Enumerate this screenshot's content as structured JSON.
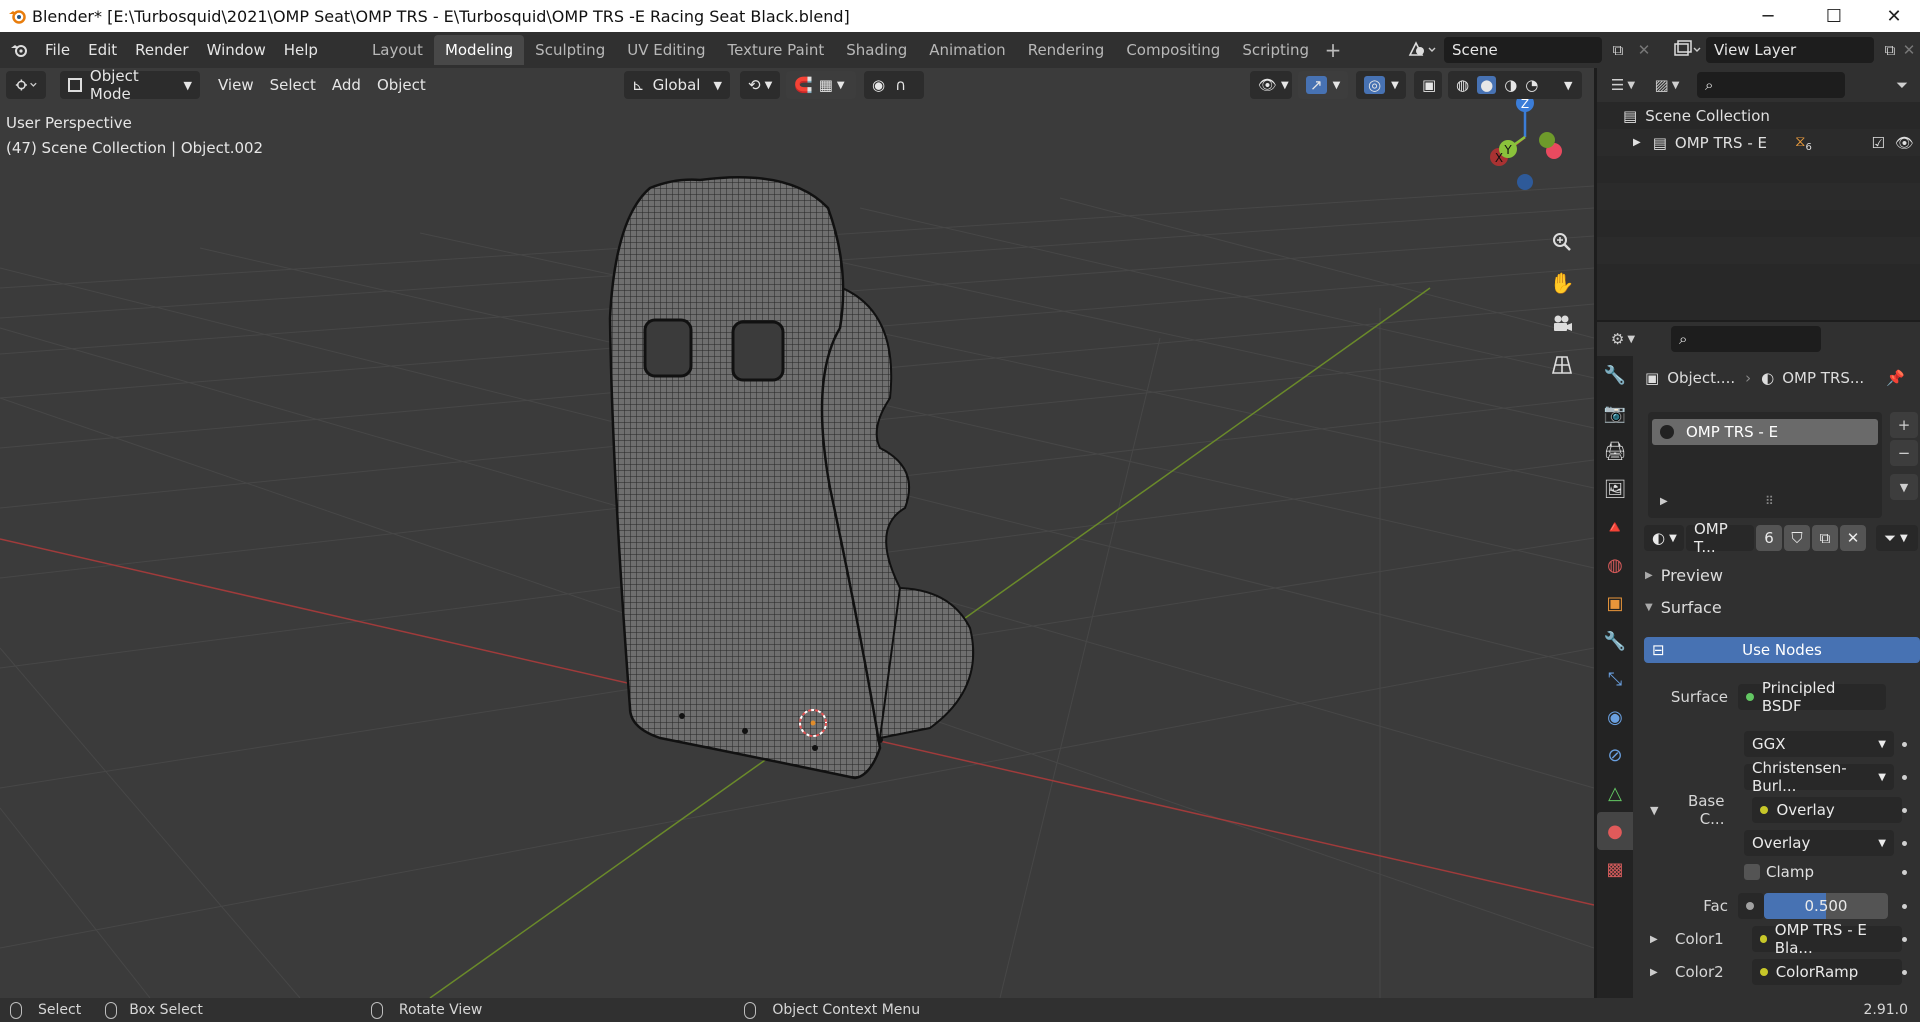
{
  "window": {
    "title": "Blender* [E:\\Turbosquid\\2021\\OMP Seat\\OMP TRS - E\\Turbosquid\\OMP TRS -E Racing Seat Black.blend]",
    "minimize": "─",
    "maximize": "☐",
    "close": "✕"
  },
  "menu": {
    "items": [
      "File",
      "Edit",
      "Render",
      "Window",
      "Help"
    ]
  },
  "workspaces": {
    "tabs": [
      "Layout",
      "Modeling",
      "Sculpting",
      "UV Editing",
      "Texture Paint",
      "Shading",
      "Animation",
      "Rendering",
      "Compositing",
      "Scripting"
    ],
    "active": "Modeling",
    "add": "+"
  },
  "scene": {
    "name": "Scene",
    "view_layer": "View Layer"
  },
  "viewport": {
    "mode": "Object Mode",
    "menus": [
      "View",
      "Select",
      "Add",
      "Object"
    ],
    "orientation": "Global",
    "overlay_text_1": "User Perspective",
    "overlay_text_2": "(47) Scene Collection | Object.002",
    "gizmo": {
      "x": "X",
      "y": "Y",
      "z": "Z"
    }
  },
  "outliner": {
    "scene_collection": "Scene Collection",
    "collection": "OMP TRS - E",
    "collection_badge": "6"
  },
  "properties": {
    "breadcrumb_object": "Object....",
    "breadcrumb_material": "OMP TRS...",
    "material_slot": "OMP TRS - E",
    "material_name": "OMP T...",
    "user_count": "6",
    "panels": {
      "preview": "Preview",
      "surface": "Surface"
    },
    "use_nodes": "Use Nodes",
    "rows": {
      "surface_label": "Surface",
      "surface_value": "Principled BSDF",
      "distribution": "GGX",
      "subsurface": "Christensen-Burl...",
      "base_color_label": "Base C...",
      "base_color_value": "Overlay",
      "blend_mode": "Overlay",
      "clamp": "Clamp",
      "fac_label": "Fac",
      "fac_value": "0.500",
      "fac_fraction": 0.5,
      "color1_label": "Color1",
      "color1_value": "OMP TRS - E Bla...",
      "color2_label": "Color2",
      "color2_value": "ColorRamp"
    },
    "colors": {
      "accent": "#4772b3",
      "socket_yellow": "#c7c729",
      "socket_green": "#63c763",
      "socket_grey": "#a1a1a1"
    }
  },
  "statusbar": {
    "select": "Select",
    "box_select": "Box Select",
    "rotate": "Rotate View",
    "context_menu": "Object Context Menu",
    "version": "2.91.0"
  }
}
